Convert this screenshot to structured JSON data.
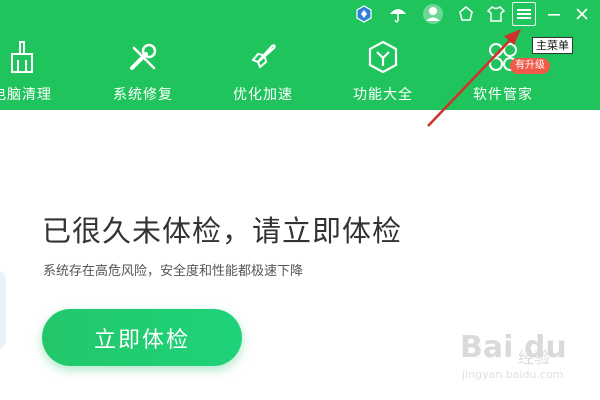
{
  "nav": {
    "items": [
      {
        "label": "电脑清理",
        "icon": "broom-icon"
      },
      {
        "label": "系统修复",
        "icon": "wrench-icon"
      },
      {
        "label": "优化加速",
        "icon": "rocket-icon"
      },
      {
        "label": "功能大全",
        "icon": "cube-icon"
      },
      {
        "label": "软件管家",
        "icon": "apps-icon"
      }
    ],
    "upgrade_badge": "有升级"
  },
  "titlebar": {
    "tooltip": "主菜单"
  },
  "main": {
    "headline": "已很久未体检，请立即体检",
    "subtext": "系统存在高危风险，安全度和性能都极速下降",
    "scan_button": "立即体检"
  },
  "watermark": {
    "brand": "Bai du",
    "brand_suffix": "经验",
    "url": "jingyan.baidu.com"
  },
  "colors": {
    "header": "#20c45c",
    "button": "#22c76a",
    "badge": "#f05a4a",
    "arrow": "#d0302a"
  }
}
